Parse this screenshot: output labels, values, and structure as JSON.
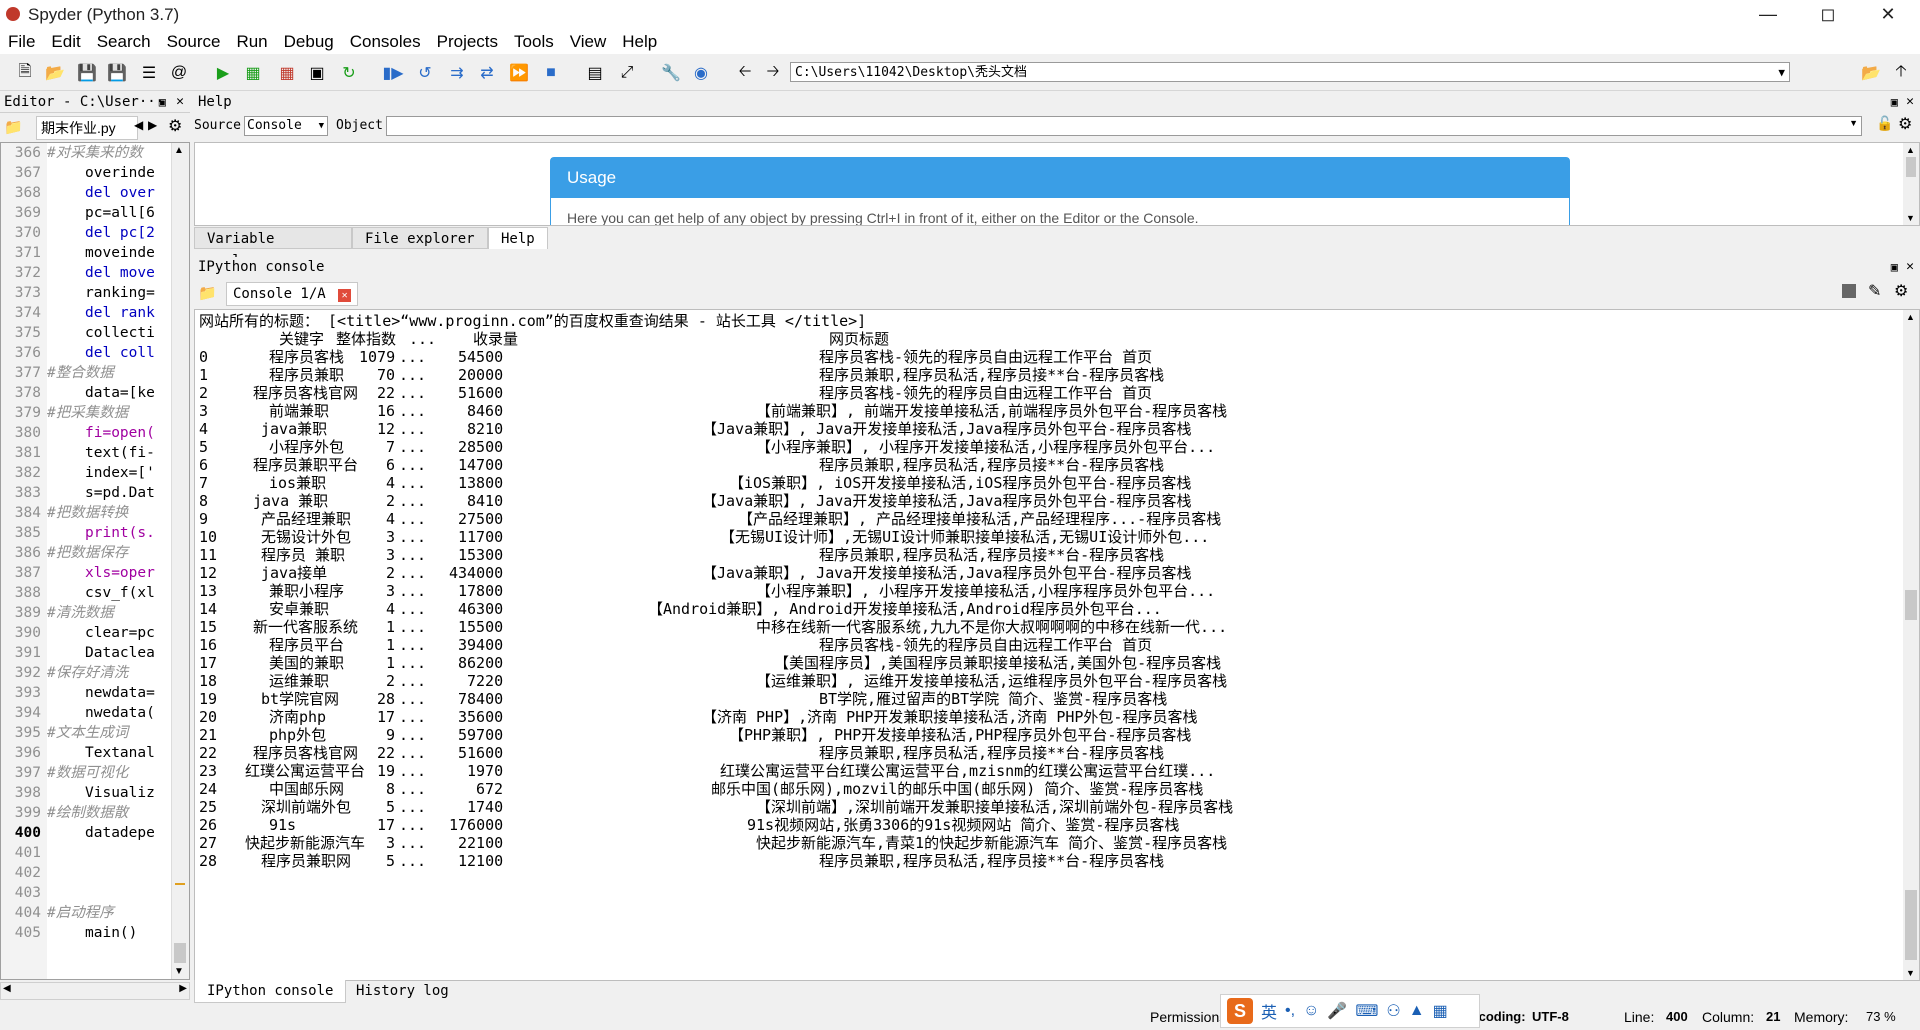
{
  "window": {
    "title": "Spyder (Python 3.7)"
  },
  "menu": [
    "File",
    "Edit",
    "Search",
    "Source",
    "Run",
    "Debug",
    "Consoles",
    "Projects",
    "Tools",
    "View",
    "Help"
  ],
  "toolbar": {
    "path": "C:\\Users\\11042\\Desktop\\秃头文档"
  },
  "editor": {
    "header": "Editor - C:\\User···",
    "tab": "期末作业.py",
    "lines": [
      {
        "n": "366",
        "t": "#对采集来的数",
        "c": "cm"
      },
      {
        "n": "367",
        "t": "overinde",
        "c": ""
      },
      {
        "n": "368",
        "t": "del over",
        "c": "kw"
      },
      {
        "n": "369",
        "t": "pc=all[6",
        "c": ""
      },
      {
        "n": "370",
        "t": "del pc[2",
        "c": "kw"
      },
      {
        "n": "371",
        "t": "moveinde",
        "c": ""
      },
      {
        "n": "372",
        "t": "del move",
        "c": "kw"
      },
      {
        "n": "373",
        "t": "ranking=",
        "c": ""
      },
      {
        "n": "374",
        "t": "del rank",
        "c": "kw"
      },
      {
        "n": "375",
        "t": "collecti",
        "c": ""
      },
      {
        "n": "376",
        "t": "del coll",
        "c": "kw"
      },
      {
        "n": "377",
        "t": "#整合数据",
        "c": "cm"
      },
      {
        "n": "378",
        "t": "data=[ke",
        "c": ""
      },
      {
        "n": "379",
        "t": "#把采集数据",
        "c": "cm"
      },
      {
        "n": "380",
        "t": "fi=open(",
        "c": "fn"
      },
      {
        "n": "381",
        "t": "text(fi-",
        "c": ""
      },
      {
        "n": "382",
        "t": "index=['",
        "c": ""
      },
      {
        "n": "383",
        "t": "s=pd.Dat",
        "c": ""
      },
      {
        "n": "384",
        "t": "#把数据转换",
        "c": "cm"
      },
      {
        "n": "385",
        "t": "print(s.",
        "c": "fn"
      },
      {
        "n": "386",
        "t": "#把数据保存",
        "c": "cm"
      },
      {
        "n": "387",
        "t": "xls=oper",
        "c": "fn"
      },
      {
        "n": "388",
        "t": "csv_f(xl",
        "c": ""
      },
      {
        "n": "389",
        "t": "#清洗数据",
        "c": "cm"
      },
      {
        "n": "390",
        "t": "clear=pc",
        "c": ""
      },
      {
        "n": "391",
        "t": "Dataclea",
        "c": ""
      },
      {
        "n": "392",
        "t": "#保存好清洗",
        "c": "cm"
      },
      {
        "n": "393",
        "t": "newdata=",
        "c": ""
      },
      {
        "n": "394",
        "t": "nwedata(",
        "c": ""
      },
      {
        "n": "395",
        "t": "#文本生成词",
        "c": "cm"
      },
      {
        "n": "396",
        "t": "Textanal",
        "c": ""
      },
      {
        "n": "397",
        "t": "#数据可视化",
        "c": "cm"
      },
      {
        "n": "398",
        "t": "Visualiz",
        "c": ""
      },
      {
        "n": "399",
        "t": "#绘制数据散",
        "c": "cm"
      },
      {
        "n": "400",
        "t": "datadepe",
        "c": ""
      },
      {
        "n": "401",
        "t": "",
        "c": ""
      },
      {
        "n": "402",
        "t": "",
        "c": ""
      },
      {
        "n": "403",
        "t": "",
        "c": ""
      },
      {
        "n": "404",
        "t": "#启动程序",
        "c": "cm"
      },
      {
        "n": "405",
        "t": "main()",
        "c": ""
      }
    ]
  },
  "help": {
    "header": "Help",
    "source_label": "Source",
    "source_value": "Console",
    "object_label": "Object",
    "usage_title": "Usage",
    "usage_text": "Here you can get help of any object by pressing Ctrl+I in front of it, either on the Editor or the Console.",
    "tabs": [
      "Variable explorer",
      "File explorer",
      "Help"
    ]
  },
  "console": {
    "header": "IPython console",
    "tab": "Console 1/A",
    "first_line": "网站所有的标题： [<title>“www.proginn.com”的百度权重查询结果 - 站长工具 </title>]",
    "columns": [
      "关键字",
      "整体指数",
      "...",
      "收录量",
      "网页标题"
    ],
    "rows": [
      [
        "0",
        "程序员客栈",
        "1079",
        "...",
        "54500",
        "程序员客栈-领先的程序员自由远程工作平台 首页"
      ],
      [
        "1",
        "程序员兼职",
        "70",
        "...",
        "20000",
        "程序员兼职,程序员私活,程序员接**台-程序员客栈"
      ],
      [
        "2",
        "程序员客栈官网",
        "22",
        "...",
        "51600",
        "程序员客栈-领先的程序员自由远程工作平台 首页"
      ],
      [
        "3",
        "前端兼职",
        "16",
        "...",
        "8460",
        "【前端兼职】, 前端开发接单接私活,前端程序员外包平台-程序员客栈"
      ],
      [
        "4",
        "java兼职",
        "12",
        "...",
        "8210",
        "【Java兼职】, Java开发接单接私活,Java程序员外包平台-程序员客栈"
      ],
      [
        "5",
        "小程序外包",
        "7",
        "...",
        "28500",
        "【小程序兼职】, 小程序开发接单接私活,小程序程序员外包平台..."
      ],
      [
        "6",
        "程序员兼职平台",
        "6",
        "...",
        "14700",
        "程序员兼职,程序员私活,程序员接**台-程序员客栈"
      ],
      [
        "7",
        "ios兼职",
        "4",
        "...",
        "13800",
        "【iOS兼职】, iOS开发接单接私活,iOS程序员外包平台-程序员客栈"
      ],
      [
        "8",
        "java 兼职",
        "2",
        "...",
        "8410",
        "【Java兼职】, Java开发接单接私活,Java程序员外包平台-程序员客栈"
      ],
      [
        "9",
        "产品经理兼职",
        "4",
        "...",
        "27500",
        "【产品经理兼职】, 产品经理接单接私活,产品经理程序...-程序员客栈"
      ],
      [
        "10",
        "无锡设计外包",
        "3",
        "...",
        "11700",
        "【无锡UI设计师】,无锡UI设计师兼职接单接私活,无锡UI设计师外包..."
      ],
      [
        "11",
        "程序员 兼职",
        "3",
        "...",
        "15300",
        "程序员兼职,程序员私活,程序员接**台-程序员客栈"
      ],
      [
        "12",
        "java接单",
        "2",
        "...",
        "434000",
        "【Java兼职】, Java开发接单接私活,Java程序员外包平台-程序员客栈"
      ],
      [
        "13",
        "兼职小程序",
        "3",
        "...",
        "17800",
        "【小程序兼职】, 小程序开发接单接私活,小程序程序员外包平台..."
      ],
      [
        "14",
        "安卓兼职",
        "4",
        "...",
        "46300",
        "【Android兼职】, Android开发接单接私活,Android程序员外包平台..."
      ],
      [
        "15",
        "新一代客服系统",
        "1",
        "...",
        "15500",
        "中移在线新一代客服系统,九九不是你大叔啊啊啊的中移在线新一代..."
      ],
      [
        "16",
        "程序员平台",
        "1",
        "...",
        "39400",
        "程序员客栈-领先的程序员自由远程工作平台 首页"
      ],
      [
        "17",
        "美国的兼职",
        "1",
        "...",
        "86200",
        "【美国程序员】,美国程序员兼职接单接私活,美国外包-程序员客栈"
      ],
      [
        "18",
        "运维兼职",
        "2",
        "...",
        "7220",
        "【运维兼职】, 运维开发接单接私活,运维程序员外包平台-程序员客栈"
      ],
      [
        "19",
        "bt学院官网",
        "28",
        "...",
        "78400",
        "BT学院,雁过留声的BT学院 简介、鉴赏-程序员客栈"
      ],
      [
        "20",
        "济南php",
        "17",
        "...",
        "35600",
        "【济南 PHP】,济南 PHP开发兼职接单接私活,济南 PHP外包-程序员客栈"
      ],
      [
        "21",
        "php外包",
        "9",
        "...",
        "59700",
        "【PHP兼职】, PHP开发接单接私活,PHP程序员外包平台-程序员客栈"
      ],
      [
        "22",
        "程序员客栈官网",
        "22",
        "...",
        "51600",
        "程序员兼职,程序员私活,程序员接**台-程序员客栈"
      ],
      [
        "23",
        "红璞公寓运营平台",
        "19",
        "...",
        "1970",
        "红璞公寓运营平台红璞公寓运营平台,mzisnm的红璞公寓运营平台红璞..."
      ],
      [
        "24",
        "中国邮乐网",
        "8",
        "...",
        "672",
        "邮乐中国(邮乐网),mozvil的邮乐中国(邮乐网) 简介、鉴赏-程序员客栈"
      ],
      [
        "25",
        "深圳前端外包",
        "5",
        "...",
        "1740",
        "【深圳前端】,深圳前端开发兼职接单接私活,深圳前端外包-程序员客栈"
      ],
      [
        "26",
        "91s",
        "17",
        "...",
        "176000",
        "91s视频网站,张勇3306的91s视频网站 简介、鉴赏-程序员客栈"
      ],
      [
        "27",
        "快起步新能源汽车",
        "3",
        "...",
        "22100",
        "快起步新能源汽车,青菜1的快起步新能源汽车 简介、鉴赏-程序员客栈"
      ],
      [
        "28",
        "程序员兼职网",
        "5",
        "...",
        "12100",
        "程序员兼职,程序员私活,程序员接**台-程序员客栈"
      ]
    ],
    "bottom_tabs": [
      "IPython console",
      "History log"
    ]
  },
  "status": {
    "permissions": "Permissions:",
    "encoding_label": "Encoding:",
    "encoding": "UTF-8",
    "line_label": "Line:",
    "line": "400",
    "column_label": "Column:",
    "column": "21",
    "memory_label": "Memory:",
    "memory": "73 %"
  },
  "ime": {
    "s": "S",
    "lang": "英"
  }
}
